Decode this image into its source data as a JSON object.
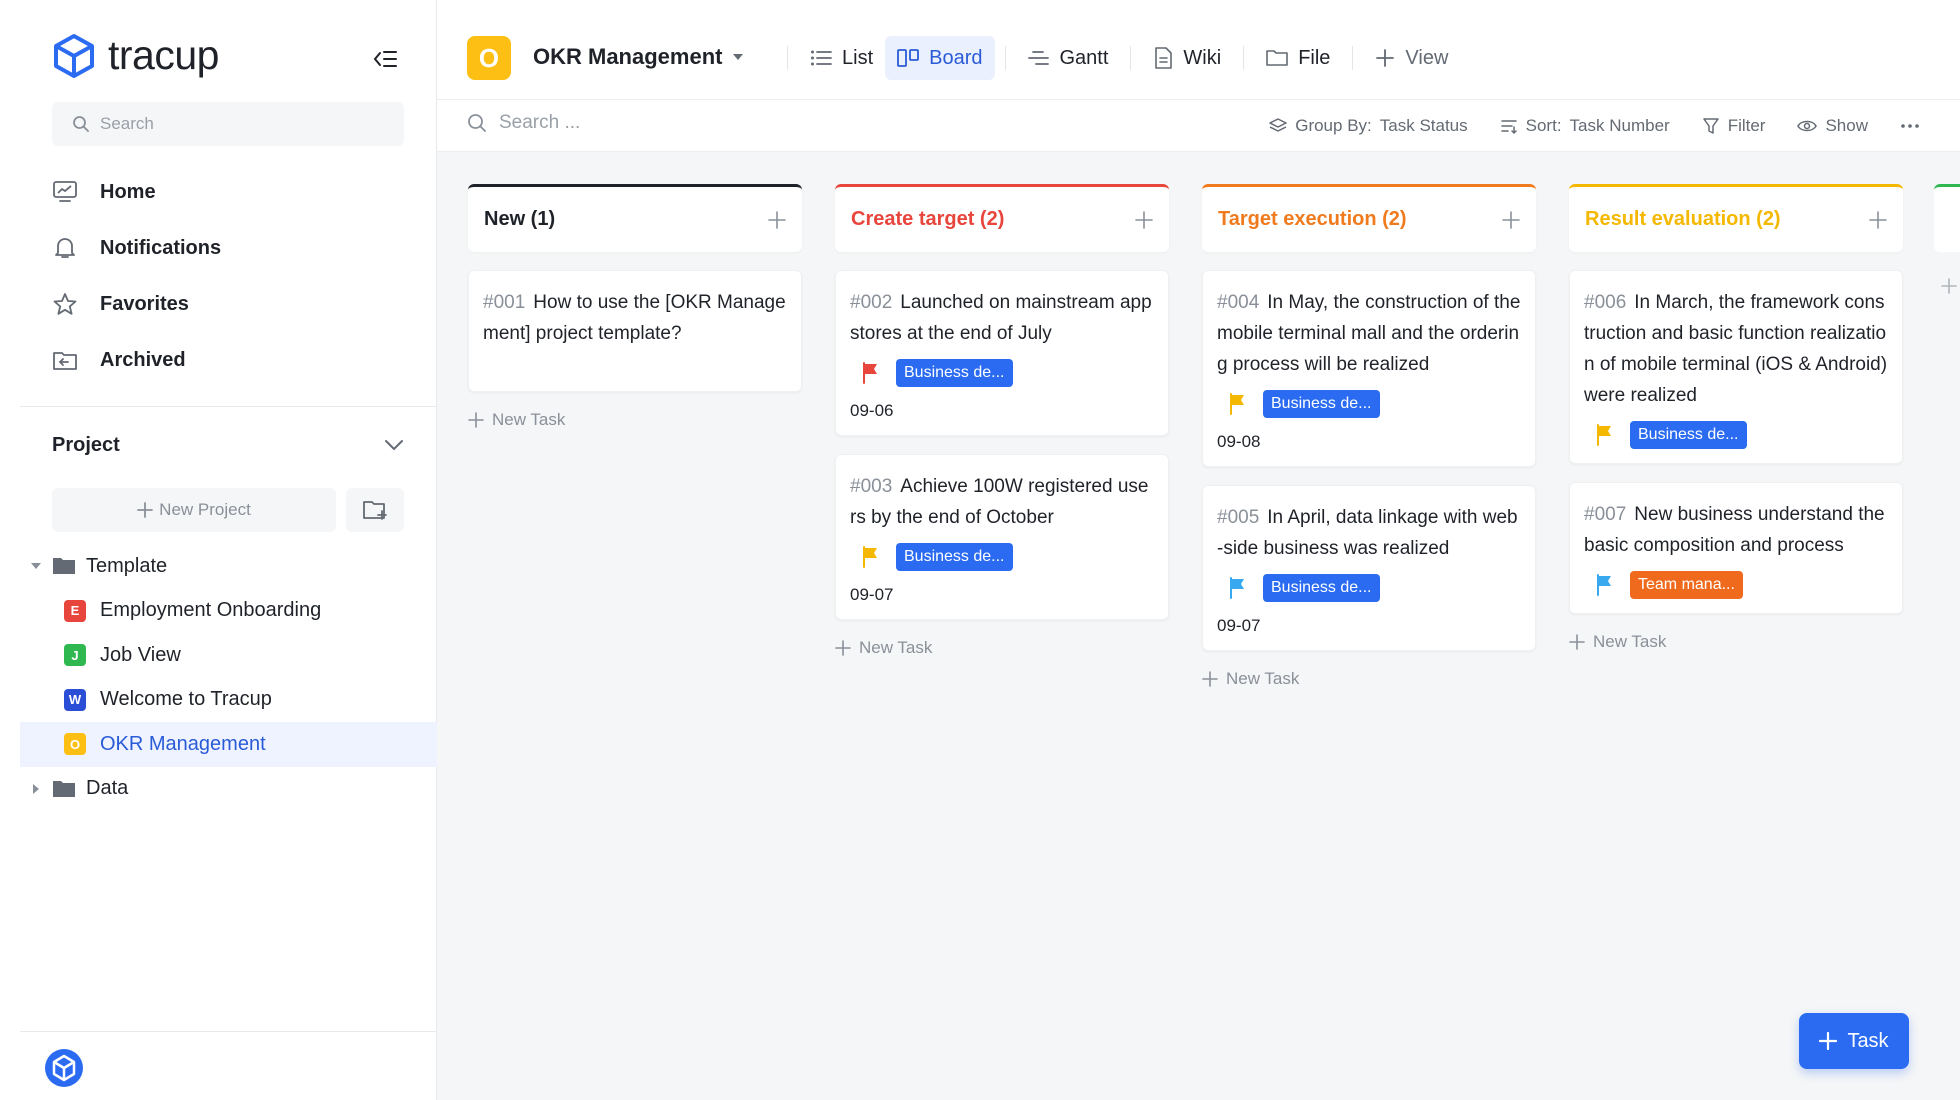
{
  "app": {
    "name": "tracup"
  },
  "sidebar": {
    "search_placeholder": "Search",
    "nav": [
      {
        "label": "Home",
        "icon": "home-monitor-icon"
      },
      {
        "label": "Notifications",
        "icon": "bell-icon"
      },
      {
        "label": "Favorites",
        "icon": "star-icon"
      },
      {
        "label": "Archived",
        "icon": "archive-icon"
      }
    ],
    "project_section": {
      "label": "Project",
      "new_project": "New Project"
    },
    "tree": [
      {
        "label": "Template",
        "type": "folder",
        "expanded": true
      },
      {
        "label": "Employment Onboarding",
        "badge": "E",
        "color": "#e8453c"
      },
      {
        "label": "Job View",
        "badge": "J",
        "color": "#2fb84f"
      },
      {
        "label": "Welcome to Tracup",
        "badge": "W",
        "color": "#2a4fd6"
      },
      {
        "label": "OKR Management",
        "badge": "O",
        "color": "#fdbf14",
        "active": true
      },
      {
        "label": "Data",
        "type": "folder",
        "expanded": false
      }
    ]
  },
  "header": {
    "project_badge": "O",
    "project_title": "OKR Management",
    "views": [
      {
        "label": "List",
        "icon": "list-icon"
      },
      {
        "label": "Board",
        "icon": "board-icon",
        "active": true
      },
      {
        "label": "Gantt",
        "icon": "gantt-icon"
      },
      {
        "label": "Wiki",
        "icon": "document-icon"
      },
      {
        "label": "File",
        "icon": "folder-icon"
      },
      {
        "label": "View",
        "icon": "plus-icon"
      }
    ]
  },
  "toolbar": {
    "search_placeholder": "Search ...",
    "group_by_label": "Group By:",
    "group_by_value": "Task Status",
    "sort_label": "Sort:",
    "sort_value": "Task Number",
    "filter": "Filter",
    "show": "Show"
  },
  "board": {
    "new_task_label": "New Task",
    "columns": [
      {
        "title": "New (1)",
        "color": "#1f2329",
        "cards": [
          {
            "num": "#001",
            "text": "How to use the [OKR Management] project template?"
          }
        ]
      },
      {
        "title": "Create target (2)",
        "color": "#e8453c",
        "cards": [
          {
            "num": "#002",
            "text": "Launched on mainstream app stores at the end of July",
            "flag": "#e8453c",
            "tag": "Business de...",
            "tag_color": "#2a6bf2",
            "date": "09-06"
          },
          {
            "num": "#003",
            "text": "Achieve 100W registered users by the end of October",
            "flag": "#f5b800",
            "tag": "Business de...",
            "tag_color": "#2a6bf2",
            "date": "09-07"
          }
        ]
      },
      {
        "title": "Target execution (2)",
        "color": "#f07b1e",
        "cards": [
          {
            "num": "#004",
            "text": "In May, the construction of the mobile terminal mall and the ordering process will be realized",
            "flag": "#f5b800",
            "tag": "Business de...",
            "tag_color": "#2a6bf2",
            "date": "09-08"
          },
          {
            "num": "#005",
            "text": "In April, data linkage with web-side business was realized",
            "flag": "#38a8ef",
            "tag": "Business de...",
            "tag_color": "#2a6bf2",
            "date": "09-07"
          }
        ]
      },
      {
        "title": "Result evaluation (2)",
        "color": "#f5b800",
        "cards": [
          {
            "num": "#006",
            "text": "In March, the framework construction and basic function realization of mobile terminal (iOS & Android) were realized",
            "flag": "#f5b800",
            "tag": "Business de...",
            "tag_color": "#2a6bf2"
          },
          {
            "num": "#007",
            "text": "New business understand the basic composition and process",
            "flag": "#38a8ef",
            "tag": "Team mana...",
            "tag_color": "#f06a1e"
          }
        ]
      }
    ]
  },
  "fab": {
    "label": "Task"
  }
}
